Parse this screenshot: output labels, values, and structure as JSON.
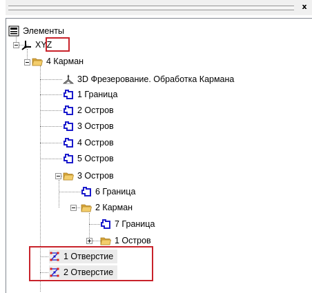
{
  "window": {
    "close_label": "x"
  },
  "tree": {
    "root": "Элементы",
    "nodes": [
      {
        "key": "xyz",
        "label": "XYZ",
        "icon": "axes-icon"
      },
      {
        "key": "karman4",
        "label": "4 Карман",
        "icon": "folder-icon"
      },
      {
        "key": "op3d",
        "label": "3D Фрезерование. Обработка Кармана",
        "icon": "milling-operation-icon"
      },
      {
        "key": "gr1",
        "label": "1 Граница",
        "icon": "contour-icon"
      },
      {
        "key": "os2",
        "label": "2 Остров",
        "icon": "contour-icon"
      },
      {
        "key": "os3",
        "label": "3 Остров",
        "icon": "contour-icon"
      },
      {
        "key": "os4",
        "label": "4 Остров",
        "icon": "contour-icon"
      },
      {
        "key": "os5",
        "label": "5 Остров",
        "icon": "contour-icon"
      },
      {
        "key": "f_os3",
        "label": "3 Остров",
        "icon": "folder-icon"
      },
      {
        "key": "gr6",
        "label": "6 Граница",
        "icon": "contour-icon"
      },
      {
        "key": "karman2",
        "label": "2 Карман",
        "icon": "folder-icon"
      },
      {
        "key": "gr7",
        "label": "7 Граница",
        "icon": "contour-icon"
      },
      {
        "key": "f_os1",
        "label": "1 Остров",
        "icon": "folder-icon"
      },
      {
        "key": "hole1",
        "label": "1 Отверстие",
        "icon": "hole-icon"
      },
      {
        "key": "hole2",
        "label": "2 Отверстие",
        "icon": "hole-icon"
      }
    ]
  },
  "colors": {
    "highlight": "#c8222a",
    "contour": "#1a1acc",
    "folder": "#e8b84a"
  }
}
